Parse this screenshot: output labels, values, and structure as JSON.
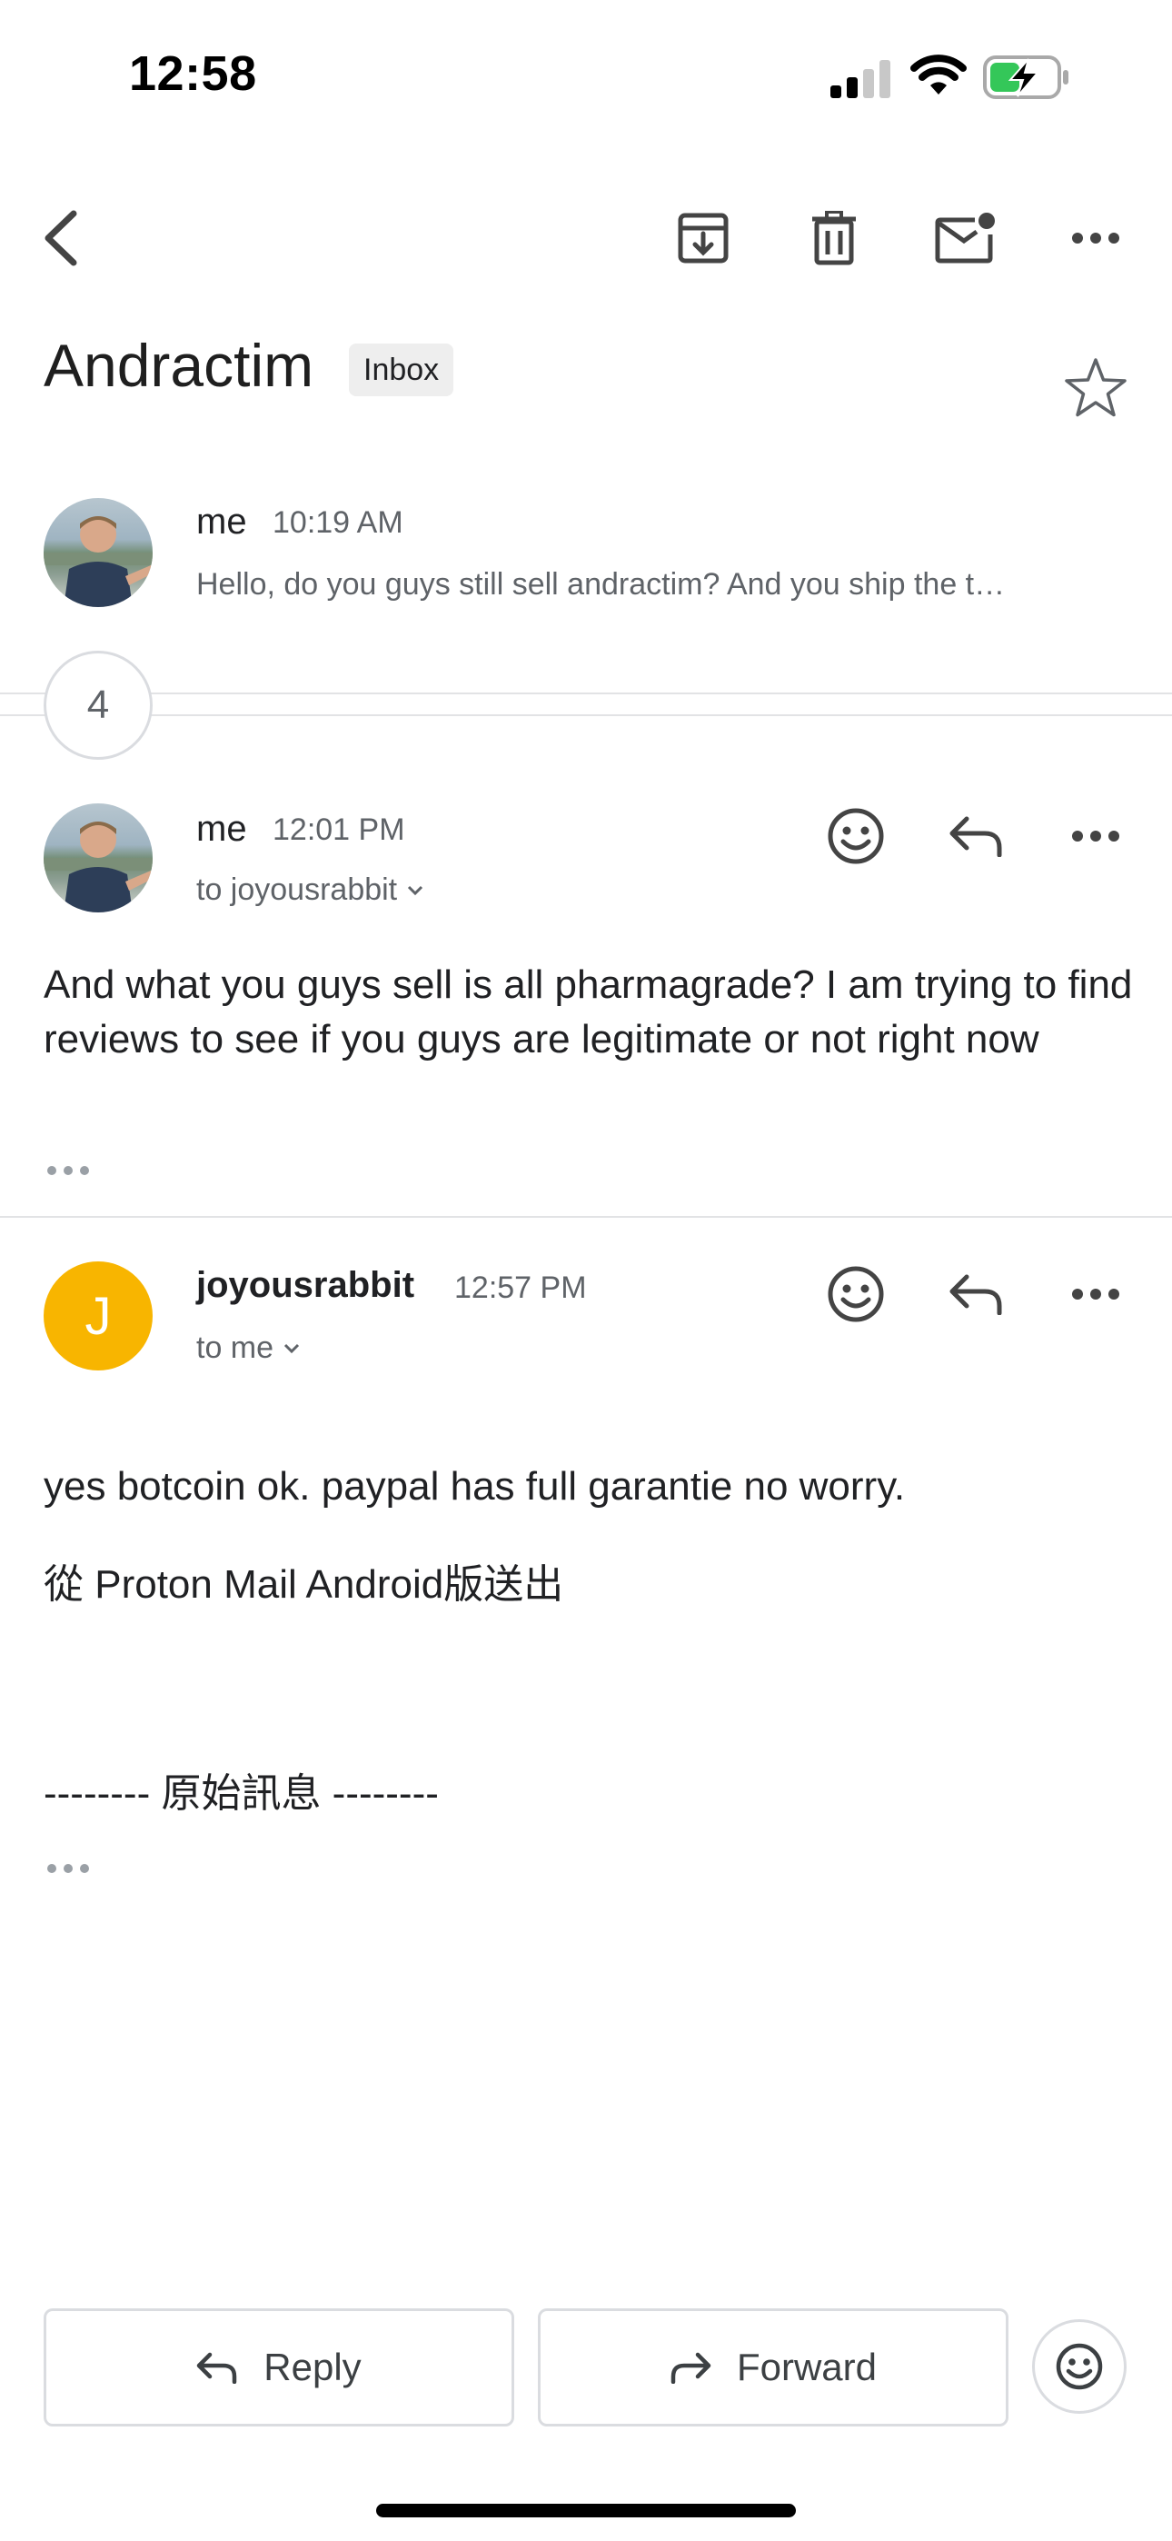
{
  "status_bar": {
    "time": "12:58"
  },
  "toolbar": {
    "back_icon": "chevron-left-icon",
    "archive_icon": "archive-icon",
    "delete_icon": "trash-icon",
    "mark_unread_icon": "mail-unread-icon",
    "more_icon": "more-horizontal-icon"
  },
  "thread": {
    "subject": "Andractim",
    "label": "Inbox",
    "collapsed_count": "4"
  },
  "messages": [
    {
      "sender": "me",
      "time": "10:19 AM",
      "snippet": "Hello, do you guys still sell andractim? And you ship the t…"
    },
    {
      "sender": "me",
      "time": "12:01 PM",
      "recipients": "to joyousrabbit",
      "body": "And what you guys sell is all pharmagrade? I am trying to find reviews to see if you guys are legitimate or not right now"
    },
    {
      "sender": "joyousrabbit",
      "avatar_letter": "J",
      "time": "12:57 PM",
      "recipients": "to me",
      "body_line1": "yes botcoin ok. paypal has full garantie no worry.",
      "body_line2": "從 Proton Mail Android版送出",
      "body_line3": "-------- 原始訊息 --------"
    }
  ],
  "actions": {
    "reply_label": "Reply",
    "forward_label": "Forward"
  },
  "colors": {
    "avatar_yellow": "#f8b500",
    "divider": "#e2e3e5",
    "secondary_text": "#5f6368",
    "battery_green": "#34c759"
  }
}
